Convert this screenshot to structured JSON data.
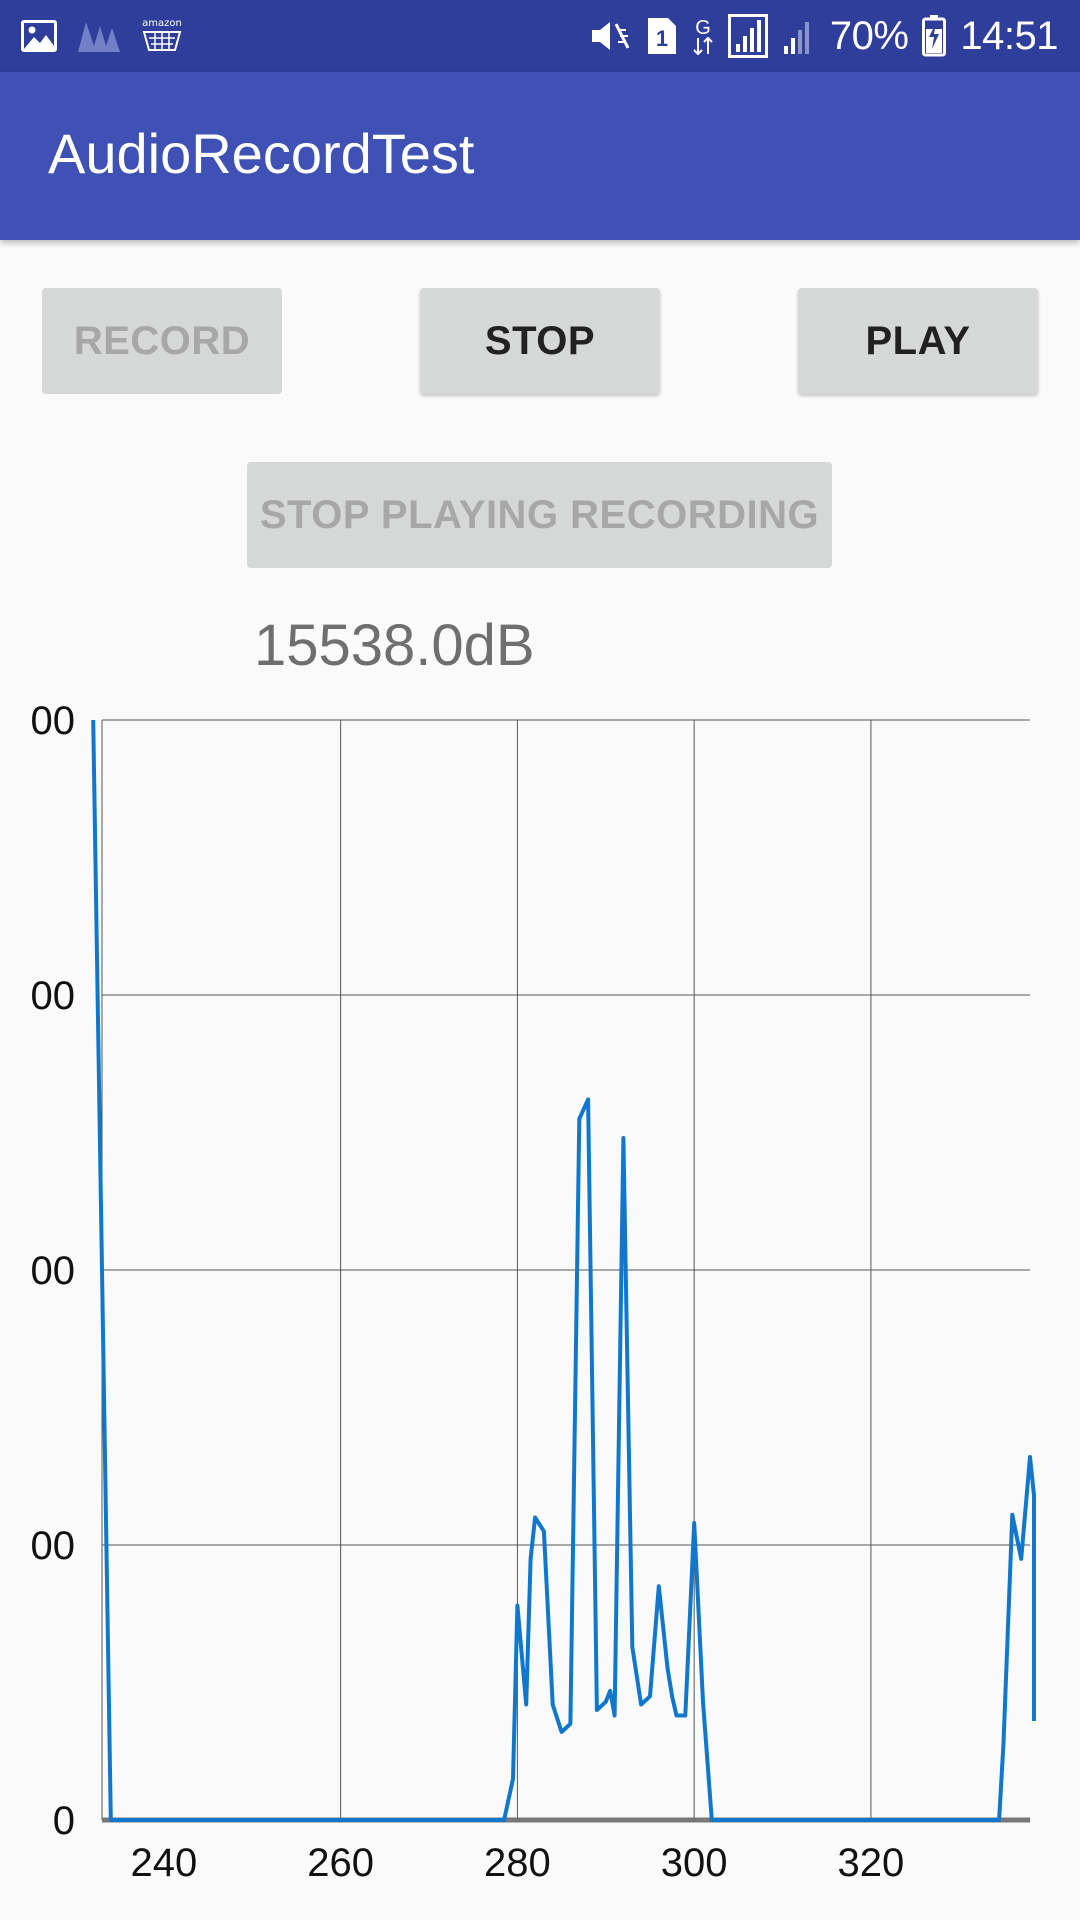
{
  "status_bar": {
    "battery": "70%",
    "time": "14:51",
    "sim_slot": "1",
    "network_type": "G",
    "left_icons": [
      "image-icon",
      "app-logo-icon",
      "amazon-shopping-icon"
    ],
    "amazon_text": "amazon",
    "right_icons": [
      "mute-vibrate-icon",
      "sim-1-icon",
      "data-g-icon",
      "signal-1-icon",
      "signal-2-icon",
      "battery-charging-icon"
    ]
  },
  "app_bar": {
    "title": "AudioRecordTest"
  },
  "buttons": {
    "record": "RECORD",
    "stop": "STOP",
    "play": "PLAY",
    "stop_playing": "STOP PLAYING RECORDING"
  },
  "db_readout": "15538.0dB",
  "colors": {
    "status_bar": "#2f3d9b",
    "app_bar": "#3f51b5",
    "series": "#1177cc",
    "button": "#d6d7d7"
  },
  "chart_data": {
    "type": "line",
    "title": "",
    "xlabel": "",
    "ylabel": "",
    "x_ticks": [
      240,
      260,
      280,
      300,
      320
    ],
    "y_tick_labels": [
      "0",
      "00",
      "00",
      "00",
      "00"
    ],
    "xlim": [
      233,
      338
    ],
    "ylim": [
      0,
      4000
    ],
    "grid": true,
    "series": [
      {
        "x": [
          232,
          234,
          234.5,
          260,
          278.5,
          279.5,
          280,
          281,
          281.5,
          282,
          283,
          284,
          285,
          286,
          287,
          288,
          289,
          290,
          290.5,
          291,
          292,
          293,
          294,
          295,
          296,
          297,
          297.5,
          298,
          299,
          300,
          301,
          302,
          303,
          304,
          305,
          306,
          307,
          307.5,
          320,
          334.5,
          335,
          336,
          337,
          338,
          339,
          340,
          341
        ],
        "y": [
          4000,
          0,
          0,
          0,
          0,
          150,
          780,
          420,
          950,
          1100,
          1050,
          420,
          320,
          350,
          2550,
          2620,
          400,
          430,
          470,
          380,
          2480,
          630,
          420,
          450,
          850,
          550,
          450,
          380,
          380,
          1080,
          430,
          0,
          0,
          0,
          0,
          0,
          0,
          0,
          0,
          0,
          280,
          1110,
          950,
          1320,
          1180,
          420,
          360
        ]
      }
    ]
  }
}
